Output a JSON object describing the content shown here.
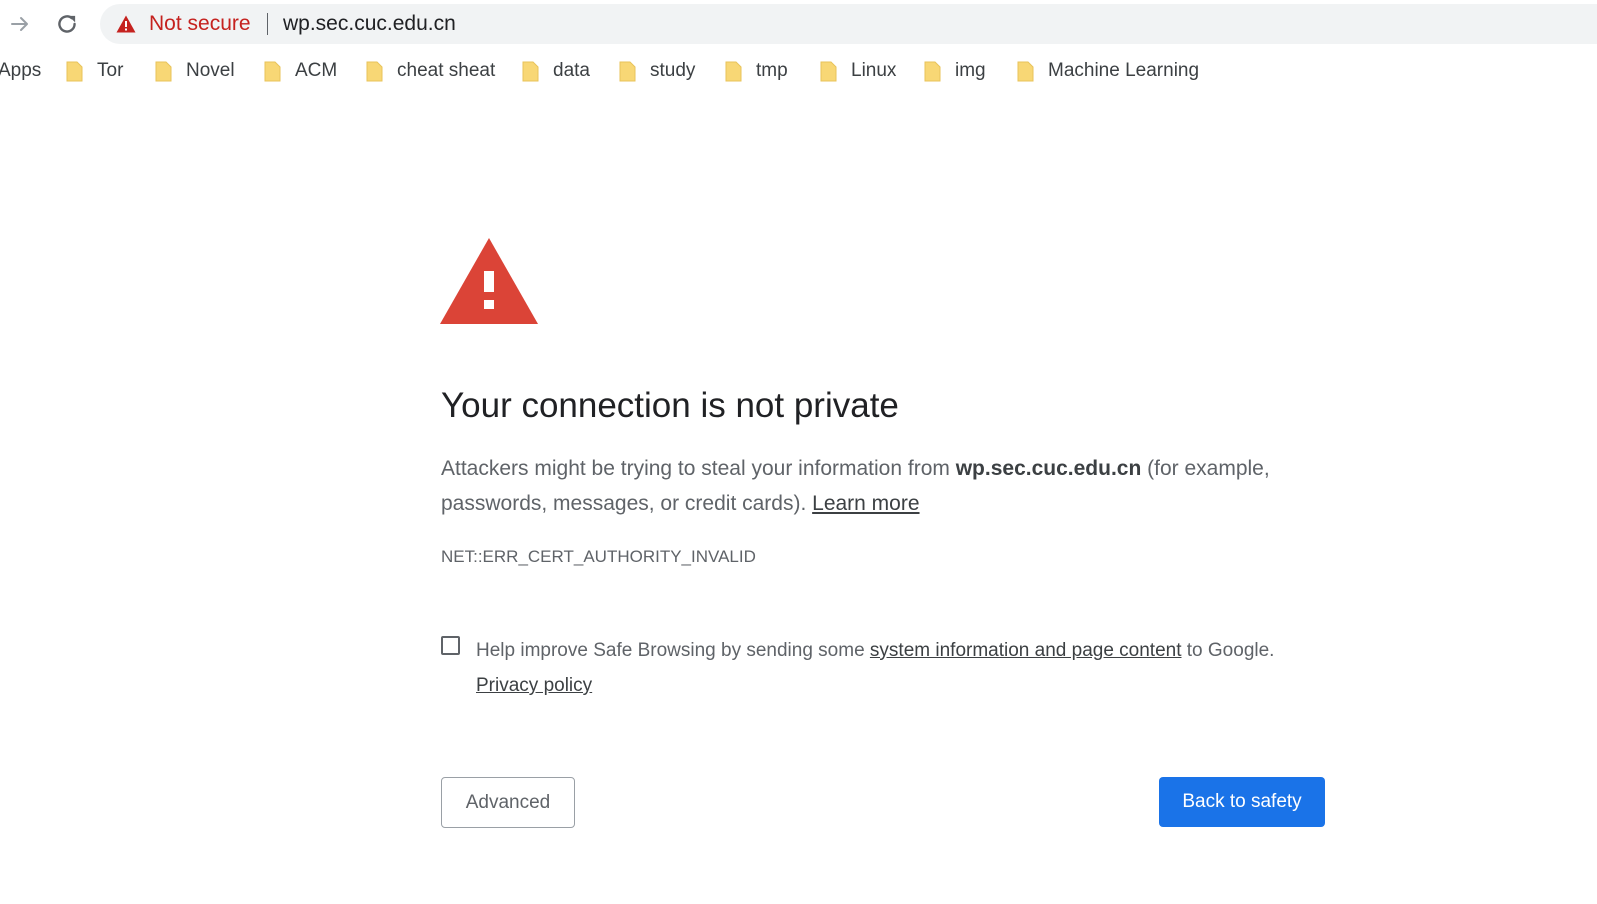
{
  "browser": {
    "security_label": "Not secure",
    "url": "wp.sec.cuc.edu.cn",
    "accent_warning": "#c5221f"
  },
  "bookmarks": {
    "apps_label": "Apps",
    "items": [
      {
        "label": "Tor",
        "icon": "folder-icon"
      },
      {
        "label": "Novel",
        "icon": "folder-icon"
      },
      {
        "label": "ACM",
        "icon": "folder-icon"
      },
      {
        "label": "cheat sheat",
        "icon": "folder-icon"
      },
      {
        "label": "data",
        "icon": "folder-icon"
      },
      {
        "label": "study",
        "icon": "folder-icon"
      },
      {
        "label": "tmp",
        "icon": "folder-icon"
      },
      {
        "label": "Linux",
        "icon": "folder-icon"
      },
      {
        "label": "img",
        "icon": "folder-icon"
      },
      {
        "label": "Machine Learning",
        "icon": "folder-icon"
      }
    ]
  },
  "interstitial": {
    "title": "Your connection is not private",
    "explanation_pre": "Attackers might be trying to steal your information from ",
    "explanation_host": "wp.sec.cuc.edu.cn",
    "explanation_post": " (for example, passwords, messages, or credit cards). ",
    "learn_more": "Learn more",
    "error_code": "NET::ERR_CERT_AUTHORITY_INVALID",
    "optin_pre": "Help improve Safe Browsing by sending some ",
    "optin_link": "system information and page content",
    "optin_post": " to Google. ",
    "privacy_policy": "Privacy policy",
    "optin_checked": false,
    "advanced_button": "Advanced",
    "back_button": "Back to safety",
    "warning_color": "#db4437",
    "primary_color": "#1a73e8"
  }
}
